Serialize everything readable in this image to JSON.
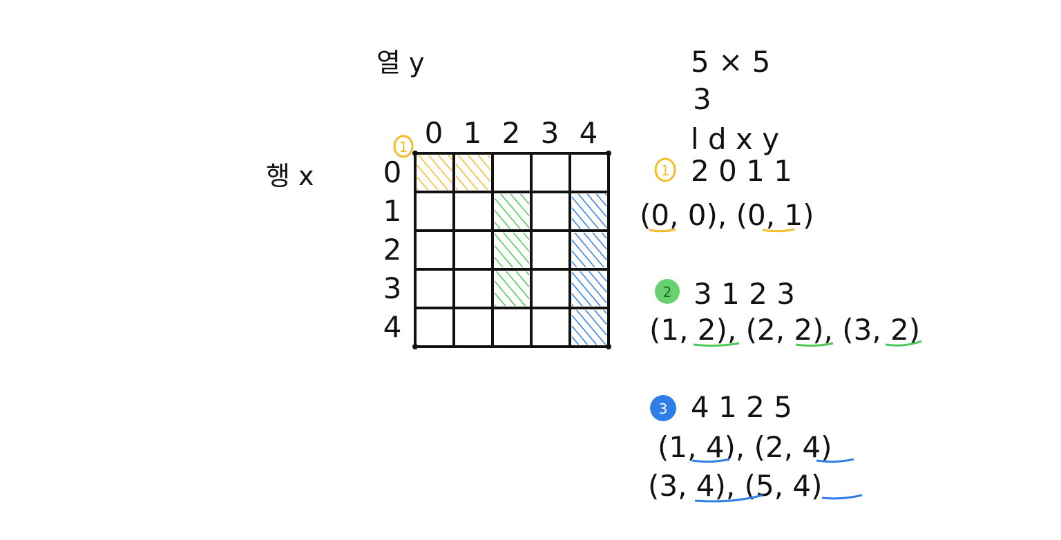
{
  "labels": {
    "column_axis": "열 y",
    "row_axis": "행 x"
  },
  "grid": {
    "size": 5,
    "col_indices": [
      "0",
      "1",
      "2",
      "3",
      "4"
    ],
    "row_indices": [
      "0",
      "1",
      "2",
      "3",
      "4"
    ],
    "filled_cells": [
      {
        "row": 0,
        "col": 0,
        "group": 1
      },
      {
        "row": 0,
        "col": 1,
        "group": 1
      },
      {
        "row": 1,
        "col": 2,
        "group": 2
      },
      {
        "row": 2,
        "col": 2,
        "group": 2
      },
      {
        "row": 3,
        "col": 2,
        "group": 2
      },
      {
        "row": 1,
        "col": 4,
        "group": 3
      },
      {
        "row": 2,
        "col": 4,
        "group": 3
      },
      {
        "row": 3,
        "col": 4,
        "group": 3
      },
      {
        "row": 4,
        "col": 4,
        "group": 3
      }
    ]
  },
  "colors": {
    "group1": "#f5bc2a",
    "group2": "#4cc857",
    "group3": "#2f7ee6",
    "ink": "#111111"
  },
  "header": {
    "size_line": "5 × 5",
    "count_line": "3",
    "field_names": "l d x y"
  },
  "groups": [
    {
      "marker": "1",
      "params": "2 0 1 1",
      "coord_lines": [
        "(0, 0), (0, 1)"
      ]
    },
    {
      "marker": "2",
      "params": "3 1 2 3",
      "coord_lines": [
        "(1, 2), (2, 2), (3, 2)"
      ]
    },
    {
      "marker": "3",
      "params": "4 1 2 5",
      "coord_lines": [
        "(1, 4), (2, 4)",
        "(3, 4), (5, 4)"
      ]
    }
  ]
}
